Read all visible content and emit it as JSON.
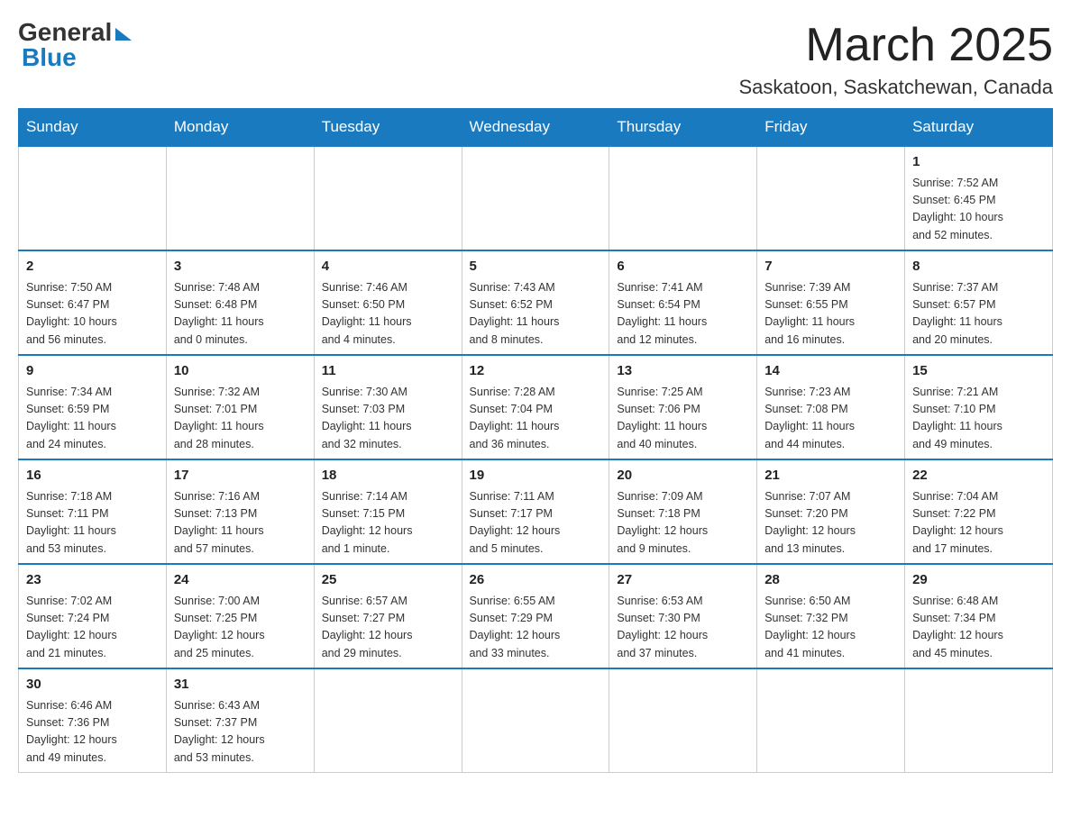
{
  "header": {
    "logo_general": "General",
    "logo_blue": "Blue",
    "month_title": "March 2025",
    "location": "Saskatoon, Saskatchewan, Canada"
  },
  "days_of_week": [
    "Sunday",
    "Monday",
    "Tuesday",
    "Wednesday",
    "Thursday",
    "Friday",
    "Saturday"
  ],
  "weeks": [
    [
      {
        "day": "",
        "info": ""
      },
      {
        "day": "",
        "info": ""
      },
      {
        "day": "",
        "info": ""
      },
      {
        "day": "",
        "info": ""
      },
      {
        "day": "",
        "info": ""
      },
      {
        "day": "",
        "info": ""
      },
      {
        "day": "1",
        "info": "Sunrise: 7:52 AM\nSunset: 6:45 PM\nDaylight: 10 hours\nand 52 minutes."
      }
    ],
    [
      {
        "day": "2",
        "info": "Sunrise: 7:50 AM\nSunset: 6:47 PM\nDaylight: 10 hours\nand 56 minutes."
      },
      {
        "day": "3",
        "info": "Sunrise: 7:48 AM\nSunset: 6:48 PM\nDaylight: 11 hours\nand 0 minutes."
      },
      {
        "day": "4",
        "info": "Sunrise: 7:46 AM\nSunset: 6:50 PM\nDaylight: 11 hours\nand 4 minutes."
      },
      {
        "day": "5",
        "info": "Sunrise: 7:43 AM\nSunset: 6:52 PM\nDaylight: 11 hours\nand 8 minutes."
      },
      {
        "day": "6",
        "info": "Sunrise: 7:41 AM\nSunset: 6:54 PM\nDaylight: 11 hours\nand 12 minutes."
      },
      {
        "day": "7",
        "info": "Sunrise: 7:39 AM\nSunset: 6:55 PM\nDaylight: 11 hours\nand 16 minutes."
      },
      {
        "day": "8",
        "info": "Sunrise: 7:37 AM\nSunset: 6:57 PM\nDaylight: 11 hours\nand 20 minutes."
      }
    ],
    [
      {
        "day": "9",
        "info": "Sunrise: 7:34 AM\nSunset: 6:59 PM\nDaylight: 11 hours\nand 24 minutes."
      },
      {
        "day": "10",
        "info": "Sunrise: 7:32 AM\nSunset: 7:01 PM\nDaylight: 11 hours\nand 28 minutes."
      },
      {
        "day": "11",
        "info": "Sunrise: 7:30 AM\nSunset: 7:03 PM\nDaylight: 11 hours\nand 32 minutes."
      },
      {
        "day": "12",
        "info": "Sunrise: 7:28 AM\nSunset: 7:04 PM\nDaylight: 11 hours\nand 36 minutes."
      },
      {
        "day": "13",
        "info": "Sunrise: 7:25 AM\nSunset: 7:06 PM\nDaylight: 11 hours\nand 40 minutes."
      },
      {
        "day": "14",
        "info": "Sunrise: 7:23 AM\nSunset: 7:08 PM\nDaylight: 11 hours\nand 44 minutes."
      },
      {
        "day": "15",
        "info": "Sunrise: 7:21 AM\nSunset: 7:10 PM\nDaylight: 11 hours\nand 49 minutes."
      }
    ],
    [
      {
        "day": "16",
        "info": "Sunrise: 7:18 AM\nSunset: 7:11 PM\nDaylight: 11 hours\nand 53 minutes."
      },
      {
        "day": "17",
        "info": "Sunrise: 7:16 AM\nSunset: 7:13 PM\nDaylight: 11 hours\nand 57 minutes."
      },
      {
        "day": "18",
        "info": "Sunrise: 7:14 AM\nSunset: 7:15 PM\nDaylight: 12 hours\nand 1 minute."
      },
      {
        "day": "19",
        "info": "Sunrise: 7:11 AM\nSunset: 7:17 PM\nDaylight: 12 hours\nand 5 minutes."
      },
      {
        "day": "20",
        "info": "Sunrise: 7:09 AM\nSunset: 7:18 PM\nDaylight: 12 hours\nand 9 minutes."
      },
      {
        "day": "21",
        "info": "Sunrise: 7:07 AM\nSunset: 7:20 PM\nDaylight: 12 hours\nand 13 minutes."
      },
      {
        "day": "22",
        "info": "Sunrise: 7:04 AM\nSunset: 7:22 PM\nDaylight: 12 hours\nand 17 minutes."
      }
    ],
    [
      {
        "day": "23",
        "info": "Sunrise: 7:02 AM\nSunset: 7:24 PM\nDaylight: 12 hours\nand 21 minutes."
      },
      {
        "day": "24",
        "info": "Sunrise: 7:00 AM\nSunset: 7:25 PM\nDaylight: 12 hours\nand 25 minutes."
      },
      {
        "day": "25",
        "info": "Sunrise: 6:57 AM\nSunset: 7:27 PM\nDaylight: 12 hours\nand 29 minutes."
      },
      {
        "day": "26",
        "info": "Sunrise: 6:55 AM\nSunset: 7:29 PM\nDaylight: 12 hours\nand 33 minutes."
      },
      {
        "day": "27",
        "info": "Sunrise: 6:53 AM\nSunset: 7:30 PM\nDaylight: 12 hours\nand 37 minutes."
      },
      {
        "day": "28",
        "info": "Sunrise: 6:50 AM\nSunset: 7:32 PM\nDaylight: 12 hours\nand 41 minutes."
      },
      {
        "day": "29",
        "info": "Sunrise: 6:48 AM\nSunset: 7:34 PM\nDaylight: 12 hours\nand 45 minutes."
      }
    ],
    [
      {
        "day": "30",
        "info": "Sunrise: 6:46 AM\nSunset: 7:36 PM\nDaylight: 12 hours\nand 49 minutes."
      },
      {
        "day": "31",
        "info": "Sunrise: 6:43 AM\nSunset: 7:37 PM\nDaylight: 12 hours\nand 53 minutes."
      },
      {
        "day": "",
        "info": ""
      },
      {
        "day": "",
        "info": ""
      },
      {
        "day": "",
        "info": ""
      },
      {
        "day": "",
        "info": ""
      },
      {
        "day": "",
        "info": ""
      }
    ]
  ]
}
